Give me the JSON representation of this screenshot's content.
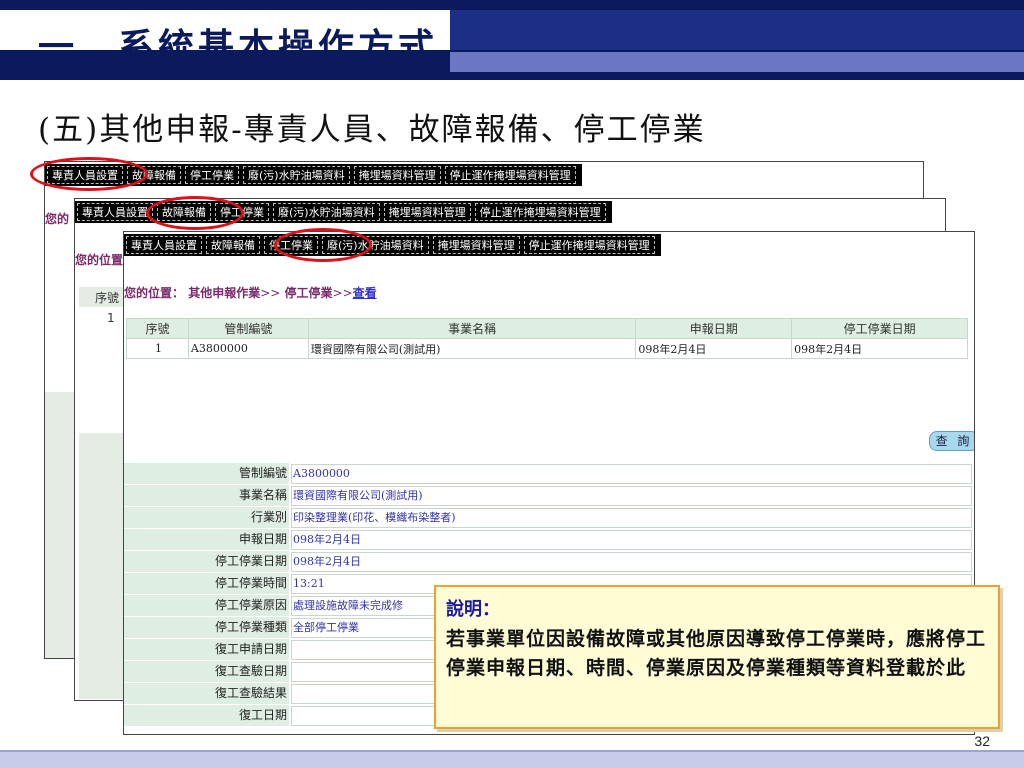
{
  "slide": {
    "title": "一、系統基本操作方式",
    "subtitle": "(五)其他申報-專責人員、故障報備、停工停業",
    "page_number": "32"
  },
  "menu": {
    "items": [
      "專責人員設置",
      "故障報備",
      "停工停業",
      "廢(污)水貯油場資料",
      "掩埋場資料管理",
      "停止運作掩埋場資料管理"
    ]
  },
  "back_windows": {
    "loc_fragment_1": "您的",
    "loc_fragment_2": "您的位置",
    "col_fragment": "序號",
    "row_fragment": "1"
  },
  "location": {
    "label": "您的位置：",
    "path1": "其他申報作業",
    "sep": ">>",
    "path2": "停工停業",
    "link": "查看"
  },
  "list_table": {
    "headers": [
      "序號",
      "管制編號",
      "事業名稱",
      "申報日期",
      "停工停業日期"
    ],
    "rows": [
      [
        "1",
        "A3800000",
        "環資國際有限公司(測試用)",
        "098年2月4日",
        "098年2月4日"
      ]
    ]
  },
  "query_button": "查 詢",
  "detail": {
    "fields": [
      {
        "label": "管制編號",
        "value": "A3800000"
      },
      {
        "label": "事業名稱",
        "value": "環資國際有限公司(測試用)"
      },
      {
        "label": "行業別",
        "value": "印染整理業(印花、模織布染整者)"
      },
      {
        "label": "申報日期",
        "value": "098年2月4日"
      },
      {
        "label": "停工停業日期",
        "value": "098年2月4日"
      },
      {
        "label": "停工停業時間",
        "value": "13:21"
      },
      {
        "label": "停工停業原因",
        "value": "處理設施故障未完成修"
      },
      {
        "label": "停工停業種類",
        "value": "全部停工停業"
      },
      {
        "label": "復工申請日期",
        "value": ""
      },
      {
        "label": "復工查驗日期",
        "value": ""
      },
      {
        "label": "復工查驗結果",
        "value": ""
      },
      {
        "label": "復工日期",
        "value": ""
      }
    ]
  },
  "callout": {
    "title": "說明：",
    "body": "若事業單位因設備故障或其他原因導致停工停業時，應將停工停業申報日期、時間、停業原因及停業種類等資料登載於此"
  },
  "colors": {
    "title_navy": "#0a1a5c",
    "highlight_red": "#e0101a",
    "callout_border": "#f0a030"
  }
}
